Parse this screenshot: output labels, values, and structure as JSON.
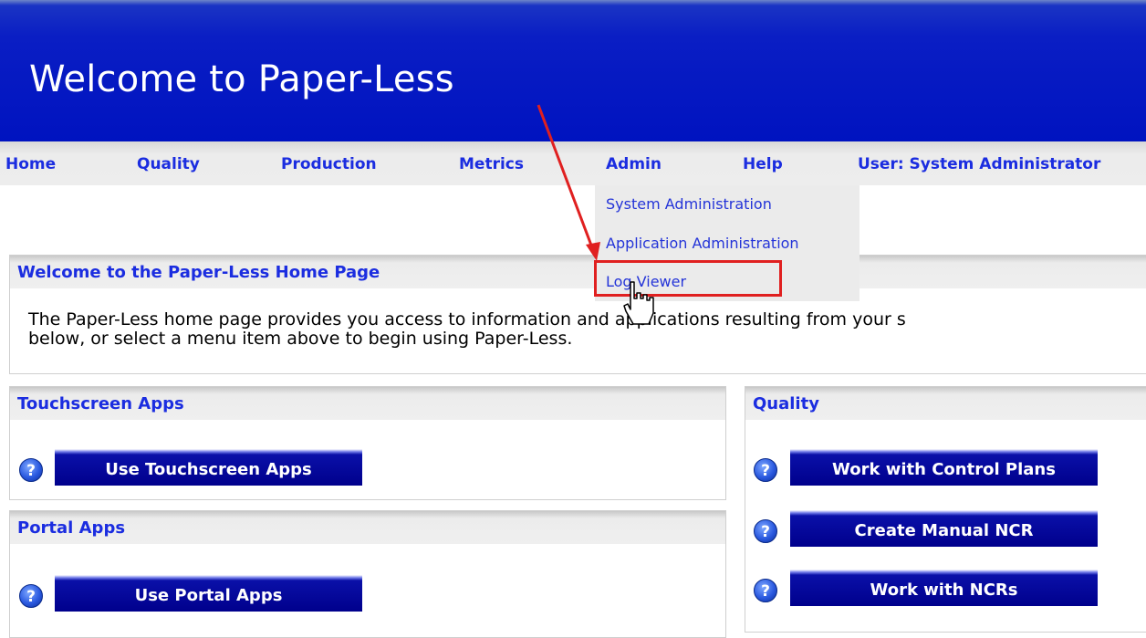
{
  "banner": {
    "title": "Welcome to Paper-Less"
  },
  "nav": {
    "home": "Home",
    "quality": "Quality",
    "production": "Production",
    "metrics": "Metrics",
    "admin": "Admin",
    "help": "Help",
    "user": "User: System Administrator"
  },
  "admin_menu": {
    "items": [
      "System Administration",
      "Application Administration",
      "Log Viewer"
    ]
  },
  "welcome_panel": {
    "title": "Welcome to the Paper-Less Home Page",
    "text_line1": "The Paper-Less home page provides you access to information and applications resulting from your s",
    "text_line2": "below, or select a menu item above to begin using Paper-Less."
  },
  "touchscreen_panel": {
    "title": "Touchscreen Apps",
    "button": "Use Touchscreen Apps"
  },
  "portal_panel": {
    "title": "Portal Apps",
    "button": "Use Portal Apps"
  },
  "quality_panel": {
    "title": "Quality",
    "buttons": [
      "Work with Control Plans",
      "Create Manual NCR",
      "Work with NCRs"
    ]
  },
  "help_icon_glyph": "?",
  "colors": {
    "banner": "#0a1ec4",
    "link": "#1b2de0",
    "button": "#00008c",
    "highlight": "#e02020"
  }
}
